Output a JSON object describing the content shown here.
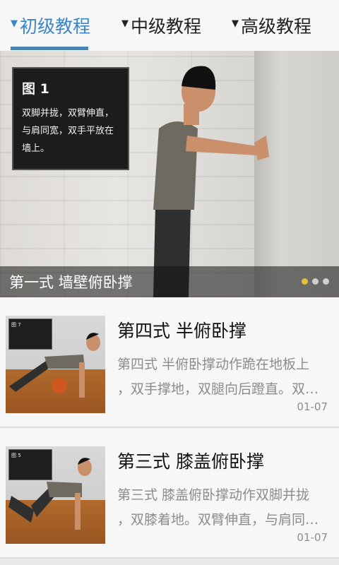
{
  "tabs": [
    {
      "arrow": "▼",
      "label": "初级教程"
    },
    {
      "arrow": "▼",
      "label": "中级教程"
    },
    {
      "arrow": "▼",
      "label": "高级教程"
    }
  ],
  "banner": {
    "sign_title": "图 1",
    "sign_lines": [
      "双脚并拢，双臂伸直，",
      "与肩同宽，双手平放在",
      "墙上。"
    ],
    "caption": "第一式  墙壁俯卧撑",
    "active_slide": 1,
    "slide_count": 3
  },
  "items": [
    {
      "title": "第四式  半俯卧撑",
      "desc_line1": "第四式  半俯卧撑动作跪在地板上",
      "desc_line2": "，双手撑地，双腿向后蹬直。双…",
      "date": "01-07",
      "thumb_sign": "图 7"
    },
    {
      "title": "第三式  膝盖俯卧撑",
      "desc_line1": "第三式  膝盖俯卧撑动作双脚并拢",
      "desc_line2": "，双膝着地。双臂伸直，与肩同…",
      "date": "01-07",
      "thumb_sign": "图 5"
    }
  ],
  "colors": {
    "accent": "#3a86c8",
    "underline": "#4a84b5",
    "active_dot": "#e0c23a"
  }
}
